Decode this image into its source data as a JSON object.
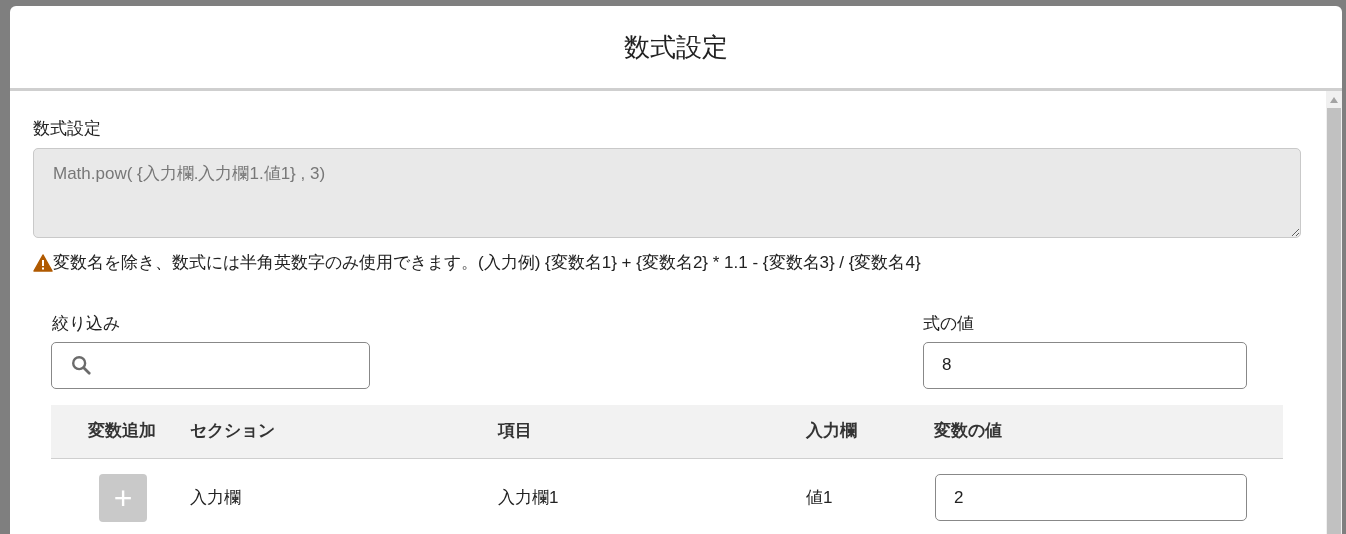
{
  "dialog": {
    "title": "数式設定"
  },
  "formula": {
    "label": "数式設定",
    "value": "Math.pow( {入力欄.入力欄1.値1} , 3)",
    "disabled": true
  },
  "notice": {
    "text": "変数名を除き、数式には半角英数字のみ使用できます。(入力例) {変数名1} + {変数名2} * 1.1 - {変数名3} / {変数名4}"
  },
  "filter": {
    "label": "絞り込み"
  },
  "result": {
    "label": "式の値",
    "value": "8"
  },
  "table": {
    "columns": [
      "変数追加",
      "セクション",
      "項目",
      "入力欄",
      "変数の値"
    ],
    "rows": [
      {
        "add_disabled": true,
        "add_label": "+",
        "section": "入力欄",
        "item": "入力欄1",
        "field": "値1",
        "value": "2"
      }
    ]
  }
}
